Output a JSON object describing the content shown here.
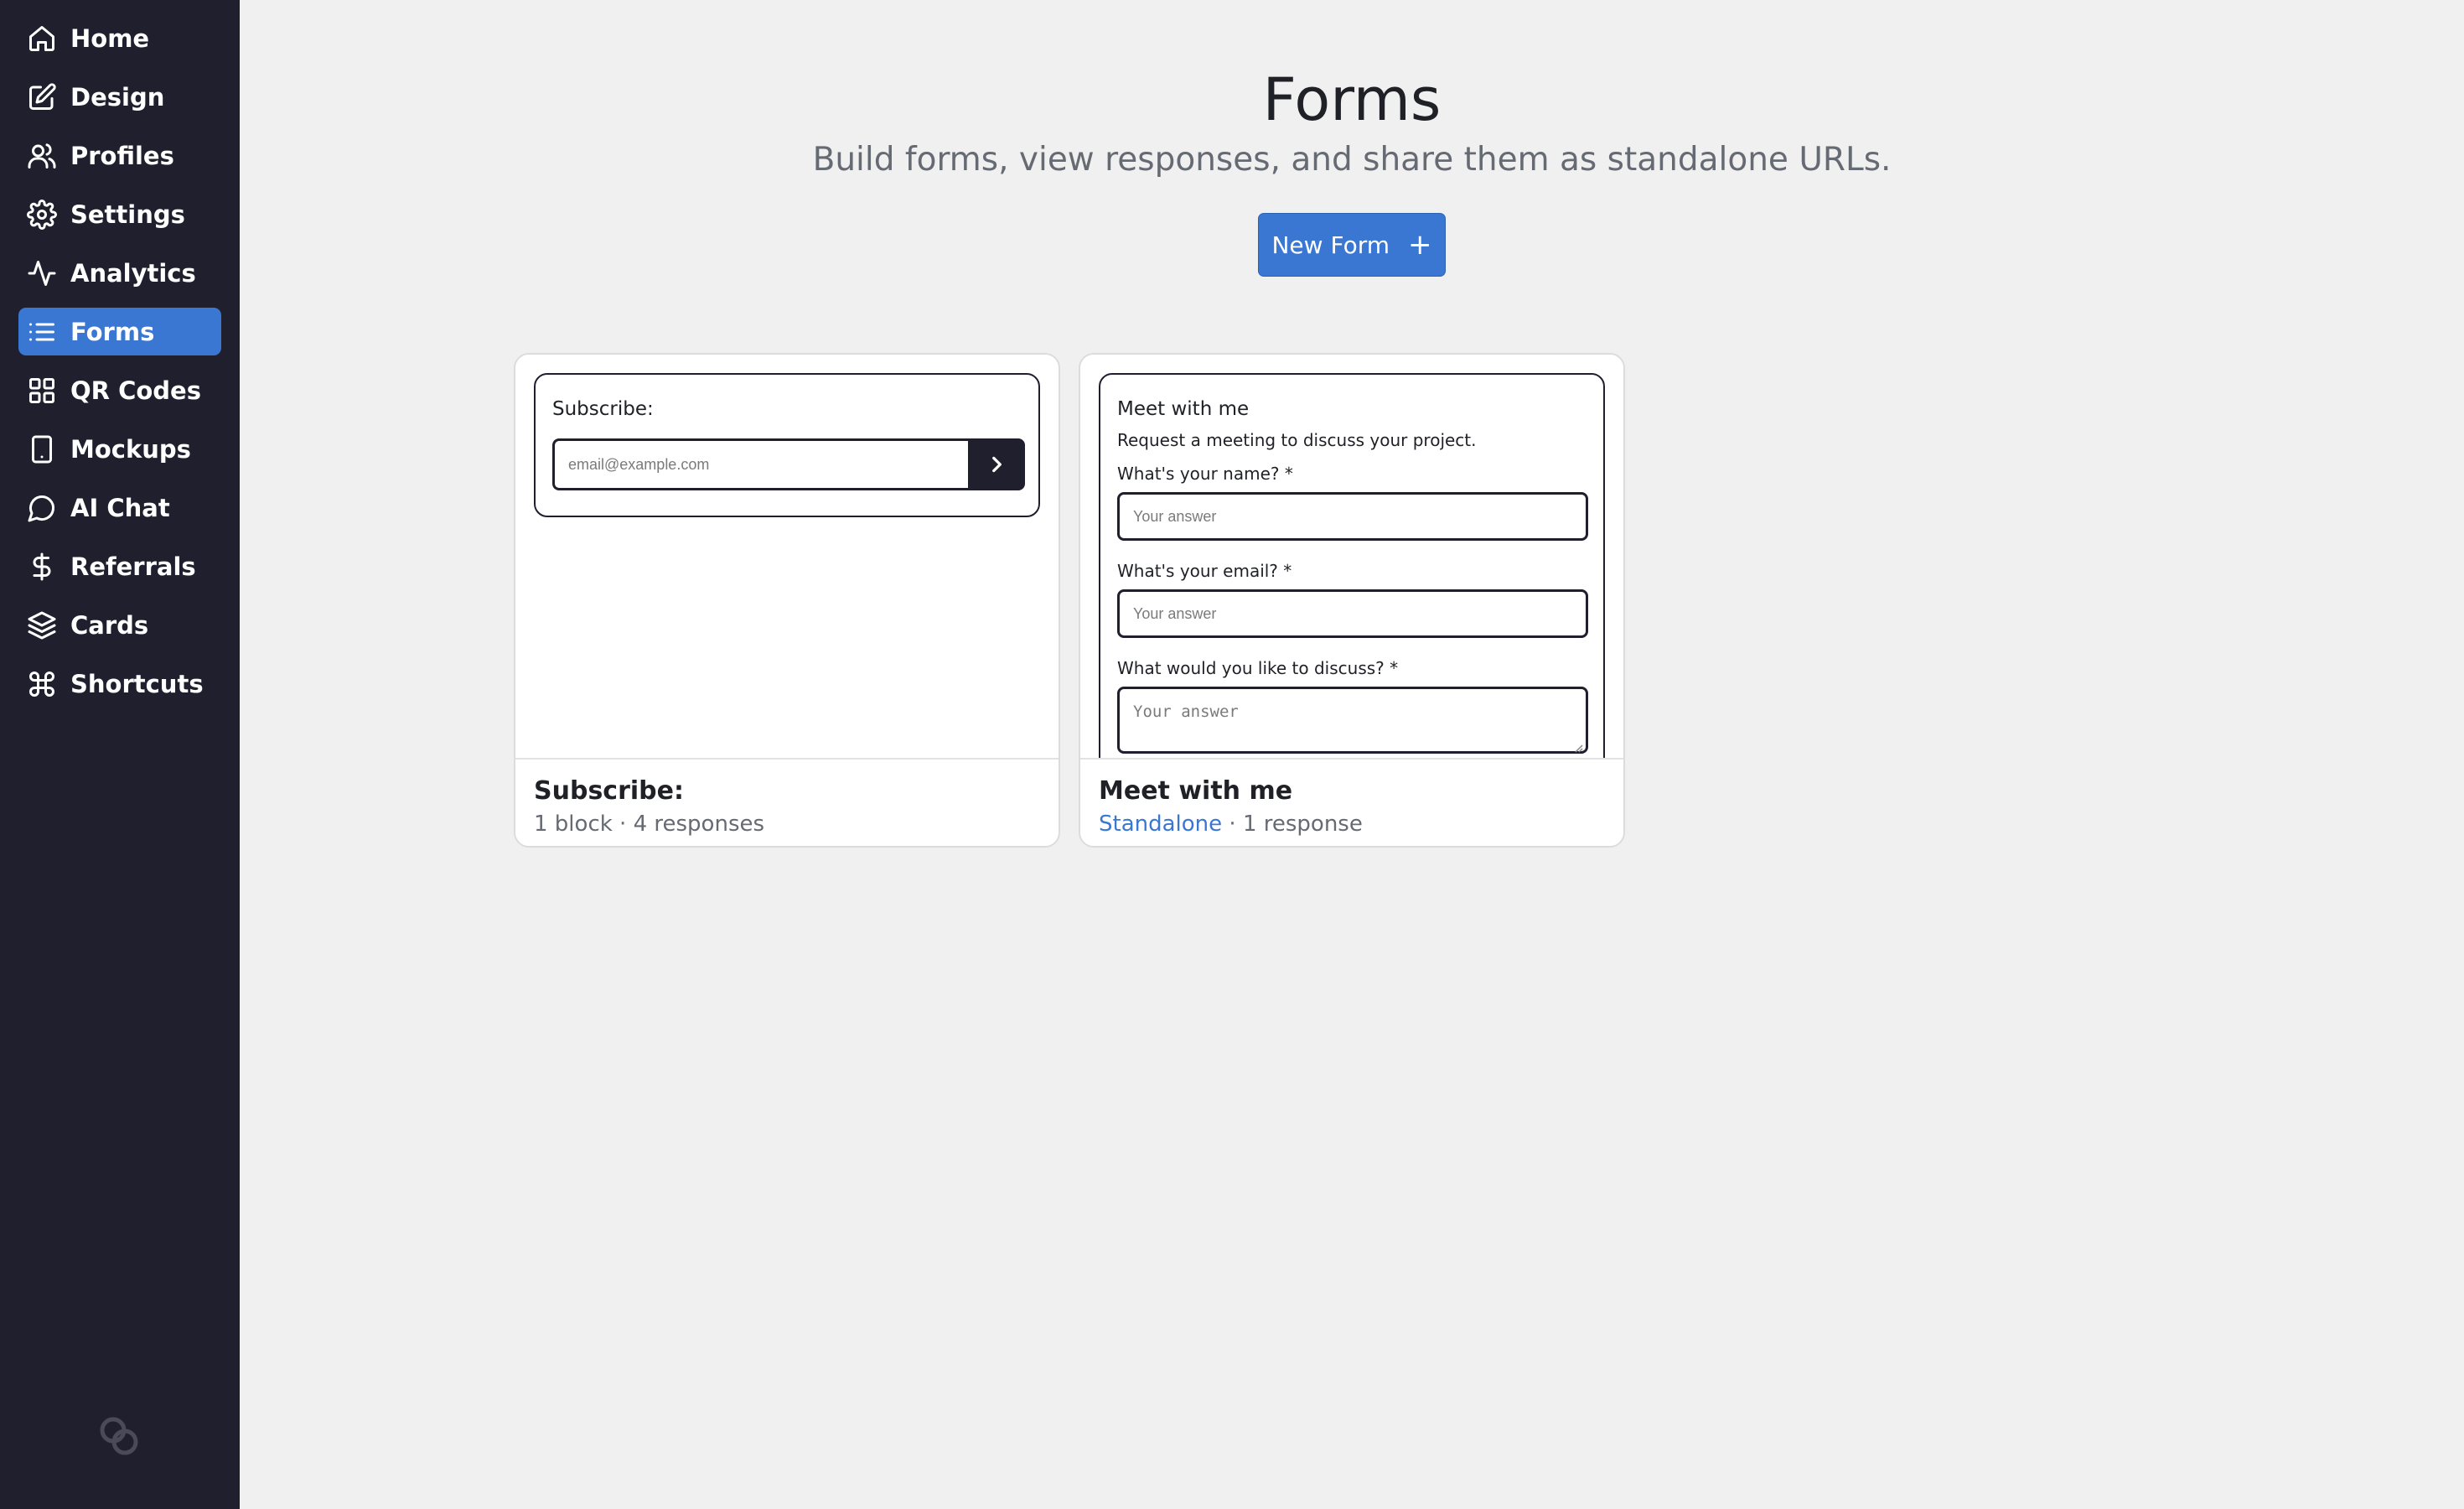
{
  "sidebar": {
    "items": [
      {
        "label": "Home",
        "icon": "home-icon",
        "active": false
      },
      {
        "label": "Design",
        "icon": "edit-icon",
        "active": false
      },
      {
        "label": "Profiles",
        "icon": "users-icon",
        "active": false
      },
      {
        "label": "Settings",
        "icon": "gear-icon",
        "active": false
      },
      {
        "label": "Analytics",
        "icon": "activity-icon",
        "active": false
      },
      {
        "label": "Forms",
        "icon": "list-icon",
        "active": true
      },
      {
        "label": "QR Codes",
        "icon": "grid-icon",
        "active": false
      },
      {
        "label": "Mockups",
        "icon": "phone-icon",
        "active": false
      },
      {
        "label": "AI Chat",
        "icon": "chat-icon",
        "active": false
      },
      {
        "label": "Referrals",
        "icon": "dollar-icon",
        "active": false
      },
      {
        "label": "Cards",
        "icon": "layers-icon",
        "active": false
      },
      {
        "label": "Shortcuts",
        "icon": "command-icon",
        "active": false
      }
    ],
    "brand_icon": "link-logo-icon"
  },
  "header": {
    "title": "Forms",
    "subtitle": "Build forms, view responses, and share them as standalone URLs.",
    "new_button_label": "New Form"
  },
  "colors": {
    "sidebar_bg": "#1f1f2e",
    "accent": "#3a77d2",
    "page_bg": "#f0f0f0"
  },
  "cards": [
    {
      "title": "Subscribe:",
      "meta": "1 block · 4 responses",
      "preview": {
        "label": "Subscribe:",
        "input_placeholder": "email@example.com"
      }
    },
    {
      "title": "Meet with me",
      "meta_link": "Standalone",
      "meta": " · 1 response",
      "preview": {
        "heading": "Meet with me",
        "description": "Request a meeting to discuss your project.",
        "q1": "What's your name? *",
        "q2": "What's your email? *",
        "q3": "What would you like to discuss? *",
        "placeholder": "Your answer"
      }
    }
  ]
}
